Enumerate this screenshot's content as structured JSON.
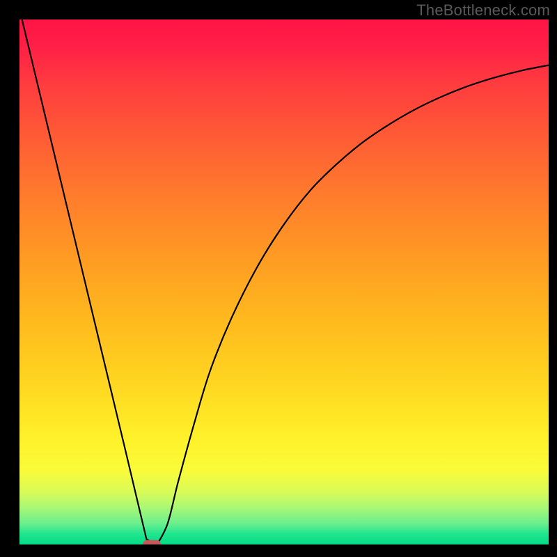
{
  "watermark": "TheBottleneck.com",
  "chart_data": {
    "type": "line",
    "title": "",
    "xlabel": "",
    "ylabel": "",
    "xlim": [
      0,
      100
    ],
    "ylim": [
      0,
      100
    ],
    "grid": false,
    "series": [
      {
        "name": "curve",
        "x": [
          0,
          5,
          10,
          15,
          20,
          24,
          26,
          28,
          30,
          33,
          36,
          40,
          45,
          50,
          55,
          60,
          65,
          70,
          75,
          80,
          85,
          90,
          95,
          100
        ],
        "values": [
          102,
          81,
          60,
          39,
          18,
          1,
          0,
          4,
          12,
          23,
          33,
          43,
          53,
          61,
          67.5,
          72.5,
          76.7,
          80.1,
          83,
          85.4,
          87.4,
          89,
          90.3,
          91.3
        ]
      }
    ],
    "marker": {
      "x": 25,
      "y": 0
    },
    "background_gradient": {
      "top": "#ff1446",
      "bottom": "#05da87"
    }
  }
}
